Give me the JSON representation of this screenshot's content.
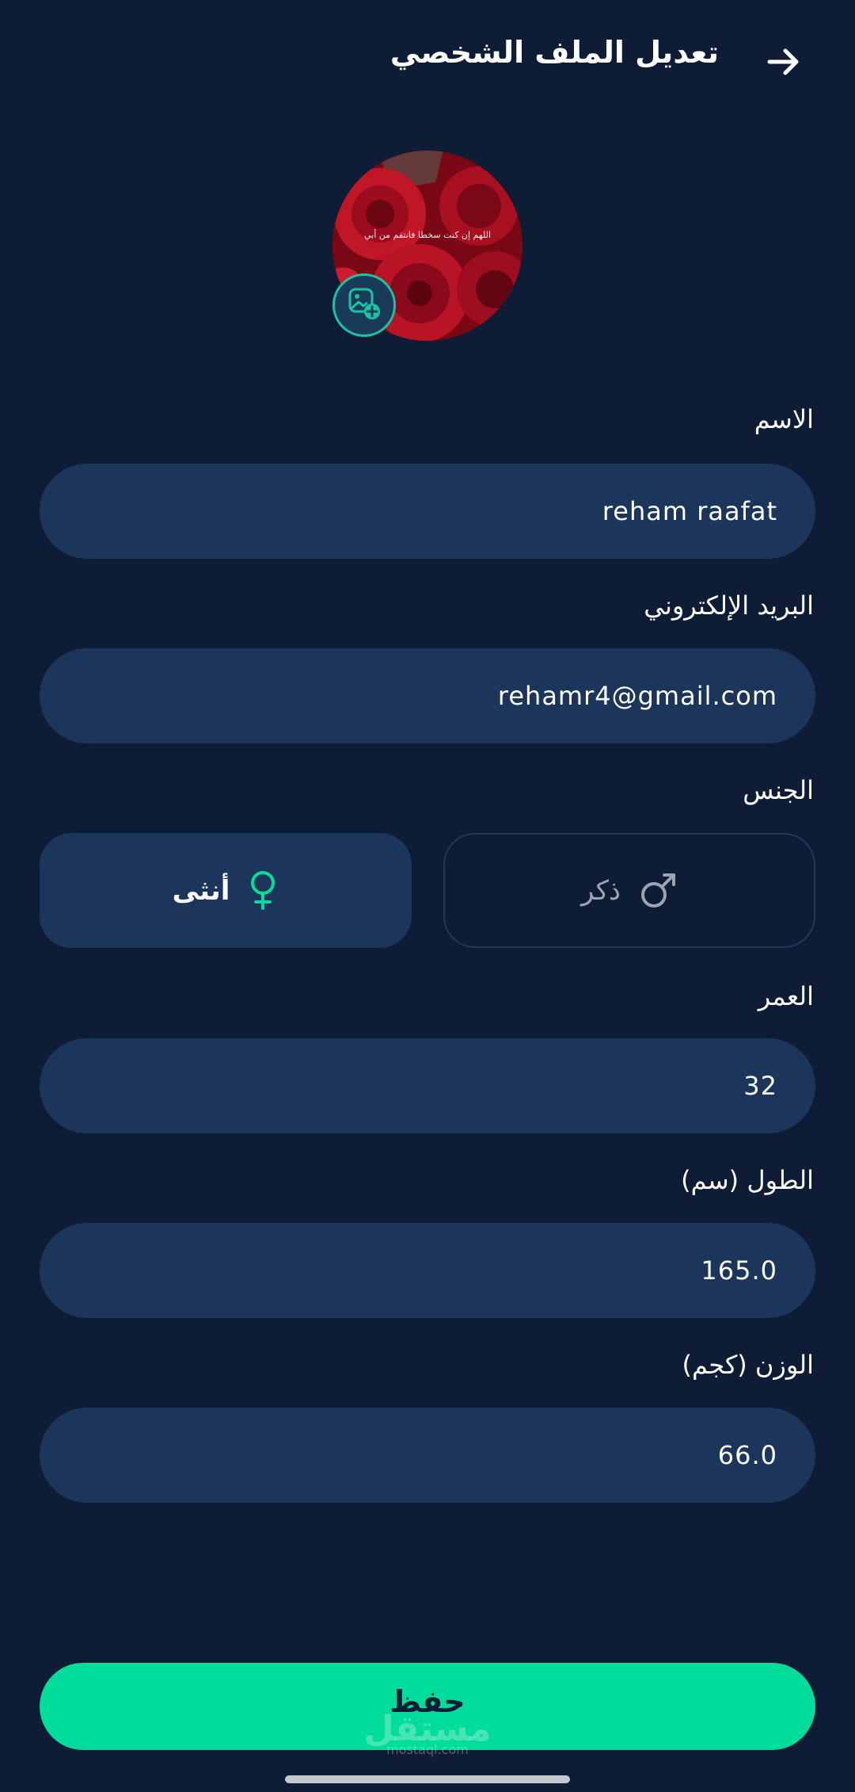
{
  "header": {
    "title": "تعديل الملف الشخصي",
    "back_icon": "arrow-right-icon"
  },
  "profile": {
    "avatar_caption": "اللهم إن كنت سخطا فانتقم من أبي",
    "photo_button_icon": "image-add-icon"
  },
  "form": {
    "name_label": "الاسم",
    "name_value": "reham raafat",
    "email_label": "البريد الإلكتروني",
    "email_value": "rehamr4@gmail.com",
    "gender_label": "الجنس",
    "gender_options": [
      {
        "label": "أنثى",
        "icon": "female-icon",
        "selected": true
      },
      {
        "label": "ذكر",
        "icon": "male-icon",
        "selected": false
      }
    ],
    "age_label": "العمر",
    "age_value": "32",
    "height_label": "الطول (سم)",
    "height_value": "165.0",
    "weight_label": "الوزن (كجم)",
    "weight_value": "66.0"
  },
  "actions": {
    "save_label": "حفظ"
  },
  "watermark": {
    "text": "مستقل",
    "sub": "mostaql.com"
  },
  "colors": {
    "background": "#0f1c36",
    "field": "#1b365a",
    "accent": "#00dc9a",
    "icon_accent": "#19c4a0"
  }
}
